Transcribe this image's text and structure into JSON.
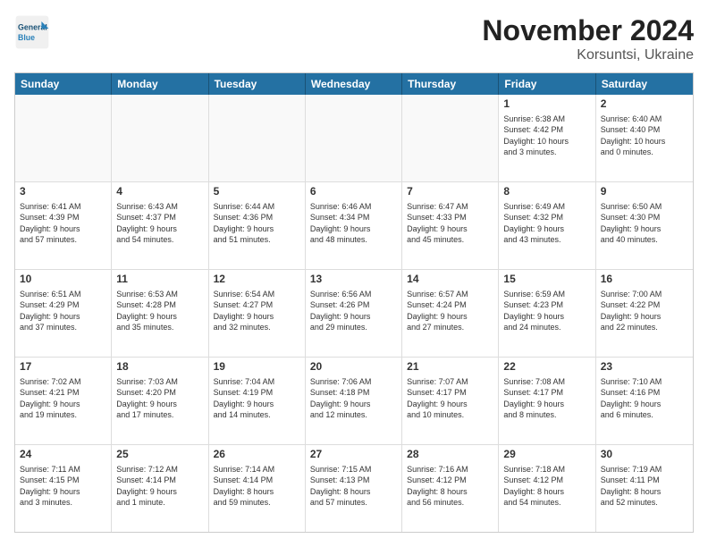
{
  "logo": {
    "line1": "General",
    "line2": "Blue"
  },
  "title": "November 2024",
  "subtitle": "Korsuntsi, Ukraine",
  "header_days": [
    "Sunday",
    "Monday",
    "Tuesday",
    "Wednesday",
    "Thursday",
    "Friday",
    "Saturday"
  ],
  "weeks": [
    [
      {
        "day": "",
        "info": ""
      },
      {
        "day": "",
        "info": ""
      },
      {
        "day": "",
        "info": ""
      },
      {
        "day": "",
        "info": ""
      },
      {
        "day": "",
        "info": ""
      },
      {
        "day": "1",
        "info": "Sunrise: 6:38 AM\nSunset: 4:42 PM\nDaylight: 10 hours\nand 3 minutes."
      },
      {
        "day": "2",
        "info": "Sunrise: 6:40 AM\nSunset: 4:40 PM\nDaylight: 10 hours\nand 0 minutes."
      }
    ],
    [
      {
        "day": "3",
        "info": "Sunrise: 6:41 AM\nSunset: 4:39 PM\nDaylight: 9 hours\nand 57 minutes."
      },
      {
        "day": "4",
        "info": "Sunrise: 6:43 AM\nSunset: 4:37 PM\nDaylight: 9 hours\nand 54 minutes."
      },
      {
        "day": "5",
        "info": "Sunrise: 6:44 AM\nSunset: 4:36 PM\nDaylight: 9 hours\nand 51 minutes."
      },
      {
        "day": "6",
        "info": "Sunrise: 6:46 AM\nSunset: 4:34 PM\nDaylight: 9 hours\nand 48 minutes."
      },
      {
        "day": "7",
        "info": "Sunrise: 6:47 AM\nSunset: 4:33 PM\nDaylight: 9 hours\nand 45 minutes."
      },
      {
        "day": "8",
        "info": "Sunrise: 6:49 AM\nSunset: 4:32 PM\nDaylight: 9 hours\nand 43 minutes."
      },
      {
        "day": "9",
        "info": "Sunrise: 6:50 AM\nSunset: 4:30 PM\nDaylight: 9 hours\nand 40 minutes."
      }
    ],
    [
      {
        "day": "10",
        "info": "Sunrise: 6:51 AM\nSunset: 4:29 PM\nDaylight: 9 hours\nand 37 minutes."
      },
      {
        "day": "11",
        "info": "Sunrise: 6:53 AM\nSunset: 4:28 PM\nDaylight: 9 hours\nand 35 minutes."
      },
      {
        "day": "12",
        "info": "Sunrise: 6:54 AM\nSunset: 4:27 PM\nDaylight: 9 hours\nand 32 minutes."
      },
      {
        "day": "13",
        "info": "Sunrise: 6:56 AM\nSunset: 4:26 PM\nDaylight: 9 hours\nand 29 minutes."
      },
      {
        "day": "14",
        "info": "Sunrise: 6:57 AM\nSunset: 4:24 PM\nDaylight: 9 hours\nand 27 minutes."
      },
      {
        "day": "15",
        "info": "Sunrise: 6:59 AM\nSunset: 4:23 PM\nDaylight: 9 hours\nand 24 minutes."
      },
      {
        "day": "16",
        "info": "Sunrise: 7:00 AM\nSunset: 4:22 PM\nDaylight: 9 hours\nand 22 minutes."
      }
    ],
    [
      {
        "day": "17",
        "info": "Sunrise: 7:02 AM\nSunset: 4:21 PM\nDaylight: 9 hours\nand 19 minutes."
      },
      {
        "day": "18",
        "info": "Sunrise: 7:03 AM\nSunset: 4:20 PM\nDaylight: 9 hours\nand 17 minutes."
      },
      {
        "day": "19",
        "info": "Sunrise: 7:04 AM\nSunset: 4:19 PM\nDaylight: 9 hours\nand 14 minutes."
      },
      {
        "day": "20",
        "info": "Sunrise: 7:06 AM\nSunset: 4:18 PM\nDaylight: 9 hours\nand 12 minutes."
      },
      {
        "day": "21",
        "info": "Sunrise: 7:07 AM\nSunset: 4:17 PM\nDaylight: 9 hours\nand 10 minutes."
      },
      {
        "day": "22",
        "info": "Sunrise: 7:08 AM\nSunset: 4:17 PM\nDaylight: 9 hours\nand 8 minutes."
      },
      {
        "day": "23",
        "info": "Sunrise: 7:10 AM\nSunset: 4:16 PM\nDaylight: 9 hours\nand 6 minutes."
      }
    ],
    [
      {
        "day": "24",
        "info": "Sunrise: 7:11 AM\nSunset: 4:15 PM\nDaylight: 9 hours\nand 3 minutes."
      },
      {
        "day": "25",
        "info": "Sunrise: 7:12 AM\nSunset: 4:14 PM\nDaylight: 9 hours\nand 1 minute."
      },
      {
        "day": "26",
        "info": "Sunrise: 7:14 AM\nSunset: 4:14 PM\nDaylight: 8 hours\nand 59 minutes."
      },
      {
        "day": "27",
        "info": "Sunrise: 7:15 AM\nSunset: 4:13 PM\nDaylight: 8 hours\nand 57 minutes."
      },
      {
        "day": "28",
        "info": "Sunrise: 7:16 AM\nSunset: 4:12 PM\nDaylight: 8 hours\nand 56 minutes."
      },
      {
        "day": "29",
        "info": "Sunrise: 7:18 AM\nSunset: 4:12 PM\nDaylight: 8 hours\nand 54 minutes."
      },
      {
        "day": "30",
        "info": "Sunrise: 7:19 AM\nSunset: 4:11 PM\nDaylight: 8 hours\nand 52 minutes."
      }
    ]
  ]
}
